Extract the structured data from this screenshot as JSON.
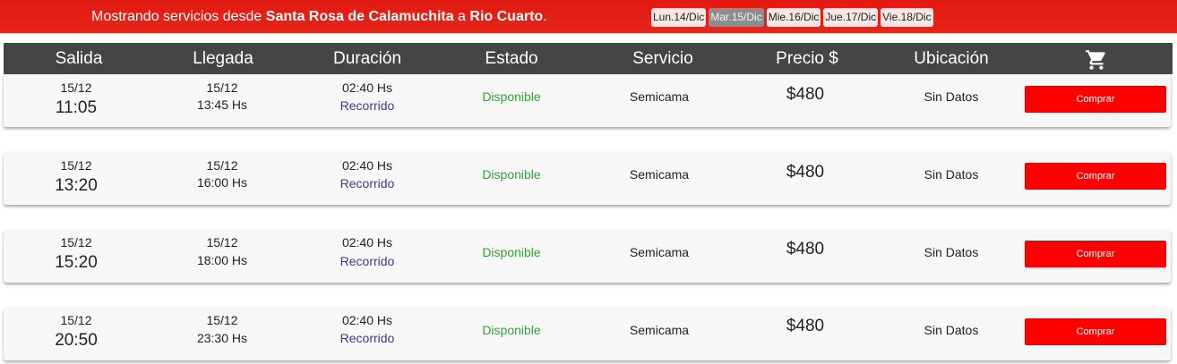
{
  "topbar": {
    "prefix": "Mostrando servicios desde ",
    "origin": "Santa Rosa de Calamuchita",
    "middle": " a ",
    "destination": "Rio Cuarto",
    "suffix": ".",
    "days": [
      {
        "label": "Lun.14/Dic",
        "active": false
      },
      {
        "label": "Mar.15/Dic",
        "active": true
      },
      {
        "label": "Mie.16/Dic",
        "active": false
      },
      {
        "label": "Jue.17/Dic",
        "active": false
      },
      {
        "label": "Vie.18/Dic",
        "active": false
      }
    ]
  },
  "table": {
    "headers": {
      "salida": "Salida",
      "llegada": "Llegada",
      "duracion": "Duración",
      "estado": "Estado",
      "servicio": "Servicio",
      "precio": "Precio $",
      "ubicacion": "Ubicación",
      "cart_icon": "cart-icon"
    },
    "rows": [
      {
        "dep_date": "15/12",
        "dep_time": "11:05",
        "arr_date": "15/12",
        "arr_time": "13:45 Hs",
        "duration": "02:40 Hs",
        "route_link": "Recorrido",
        "status": "Disponible",
        "service": "Semicama",
        "price": "$480",
        "location": "Sin Datos",
        "buy": "Comprar"
      },
      {
        "dep_date": "15/12",
        "dep_time": "13:20",
        "arr_date": "15/12",
        "arr_time": "16:00 Hs",
        "duration": "02:40 Hs",
        "route_link": "Recorrido",
        "status": "Disponible",
        "service": "Semicama",
        "price": "$480",
        "location": "Sin Datos",
        "buy": "Comprar"
      },
      {
        "dep_date": "15/12",
        "dep_time": "15:20",
        "arr_date": "15/12",
        "arr_time": "18:00 Hs",
        "duration": "02:40 Hs",
        "route_link": "Recorrido",
        "status": "Disponible",
        "service": "Semicama",
        "price": "$480",
        "location": "Sin Datos",
        "buy": "Comprar"
      },
      {
        "dep_date": "15/12",
        "dep_time": "20:50",
        "arr_date": "15/12",
        "arr_time": "23:30 Hs",
        "duration": "02:40 Hs",
        "route_link": "Recorrido",
        "status": "Disponible",
        "service": "Semicama",
        "price": "$480",
        "location": "Sin Datos",
        "buy": "Comprar"
      }
    ]
  },
  "colors": {
    "accent_red": "#e8251a",
    "header_gray": "#454545",
    "status_green": "#33a03a",
    "link_blue": "#3a3a8a",
    "button_red": "#ff0000"
  }
}
